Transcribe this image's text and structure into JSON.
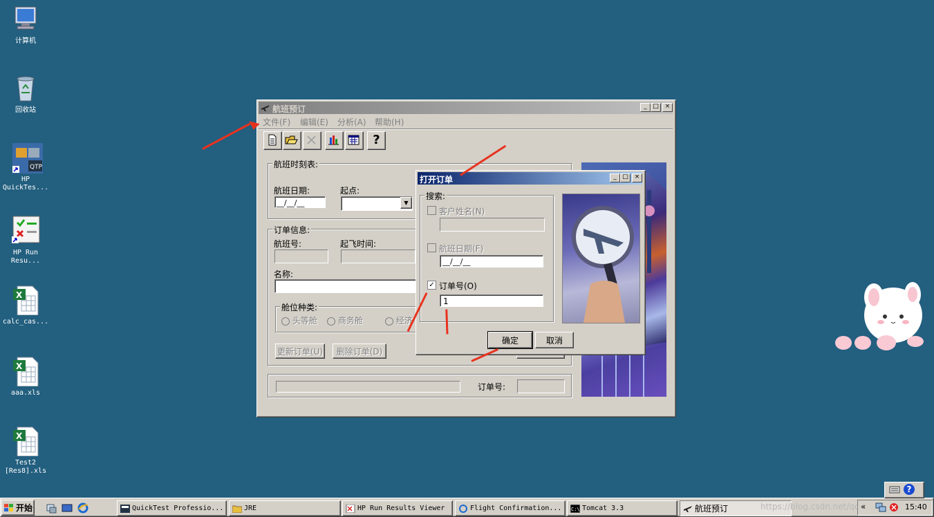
{
  "desktop": {
    "icons": [
      {
        "label": "计算机",
        "icon": "computer-icon"
      },
      {
        "label": "回收站",
        "icon": "recycle-bin-icon"
      },
      {
        "label": "HP\nQuickTes...",
        "icon": "quicktest-icon"
      },
      {
        "label": "HP Run\nResu...",
        "icon": "run-results-icon"
      },
      {
        "label": "calc_cas...",
        "icon": "excel-icon"
      },
      {
        "label": "aaa.xls",
        "icon": "excel-icon"
      },
      {
        "label": "Test2\n[Res8].xls",
        "icon": "excel-icon"
      }
    ]
  },
  "main_window": {
    "title": "航班预订",
    "menu": [
      "文件(F)",
      "编辑(E)",
      "分析(A)",
      "帮助(H)"
    ],
    "toolbar": [
      "new-order-icon",
      "open-order-icon",
      "delete-icon",
      "chart-icon",
      "calendar-icon",
      "help-icon"
    ],
    "help_glyph": "?",
    "schedule": {
      "title": "航班时刻表:",
      "date_label": "航班日期:",
      "date_value": "__/__/__",
      "from_label": "起点:"
    },
    "order": {
      "title": "订单信息:",
      "flight_no_label": "航班号:",
      "depart_time_label": "起飞时间:",
      "name_label": "名称:",
      "class_title": "舱位种类:",
      "classes": [
        "头等舱",
        "商务舱",
        "经济"
      ],
      "update_button": "更新订单(U)",
      "delete_button": "删除订单(D)"
    },
    "status": {
      "order_no_label": "订单号:"
    }
  },
  "dialog": {
    "title": "打开订单",
    "search_title": "搜索:",
    "customer_name": {
      "label": "客户姓名(N)",
      "checked": false,
      "value": ""
    },
    "flight_date": {
      "label": "航班日期(F)",
      "checked": false,
      "value": "__/__/__"
    },
    "order_no": {
      "label": "订单号(O)",
      "checked": true,
      "value": "1"
    },
    "ok_button": "确定",
    "cancel_button": "取消",
    "check_glyph": "✓"
  },
  "taskbar": {
    "start_label": "开始",
    "tasks": [
      {
        "label": "QuickTest Professio...",
        "icon": "qtp-icon"
      },
      {
        "label": "JRE",
        "icon": "folder-icon"
      },
      {
        "label": "HP Run Results Viewer",
        "icon": "results-icon"
      },
      {
        "label": "Flight Confirmation...",
        "icon": "ie-icon"
      },
      {
        "label": "Tomcat 3.3",
        "icon": "console-icon"
      },
      {
        "label": "航班预订",
        "icon": "plane-icon"
      }
    ],
    "tray_chevron": "«",
    "clock": "15:40",
    "watermark": "https://blog.csdn.net/qq_41432935"
  },
  "colors": {
    "desktop": "#235f7f",
    "titlebar_active": "#0a246a",
    "titlebar_inactive": "#808080",
    "face": "#d4d0c8",
    "arrow": "#e8321e"
  }
}
